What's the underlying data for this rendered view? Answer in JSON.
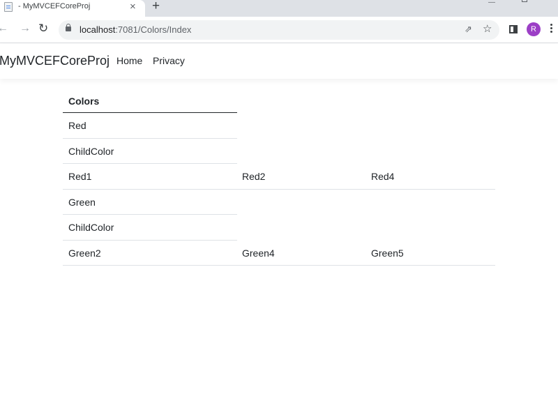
{
  "browser": {
    "tab_title": "- MyMVCEFCoreProj",
    "tab_close": "×",
    "new_tab": "+",
    "url_host": "localhost",
    "url_path": ":7081/Colors/Index",
    "avatar_letter": "R",
    "icons": [
      "document-icon",
      "back-icon",
      "forward-icon",
      "reload-icon",
      "lock-icon",
      "share-icon",
      "star-icon",
      "side-panel-icon",
      "menu-icon"
    ]
  },
  "site": {
    "brand": "MyMVCEFCoreProj",
    "nav": [
      "Home",
      "Privacy"
    ]
  },
  "table": {
    "header": "Colors",
    "rows": [
      {
        "cells": [
          "Red"
        ]
      },
      {
        "cells": [
          "ChildColor"
        ]
      },
      {
        "cells": [
          "Red1",
          "Red2",
          "Red4"
        ]
      },
      {
        "cells": [
          "Green"
        ]
      },
      {
        "cells": [
          "ChildColor"
        ]
      },
      {
        "cells": [
          "Green2",
          "Green4",
          "Green5"
        ]
      }
    ]
  },
  "colors": {
    "avatar": "#9c3fc6",
    "tabstrip": "#dee1e6",
    "text": "#212529"
  }
}
